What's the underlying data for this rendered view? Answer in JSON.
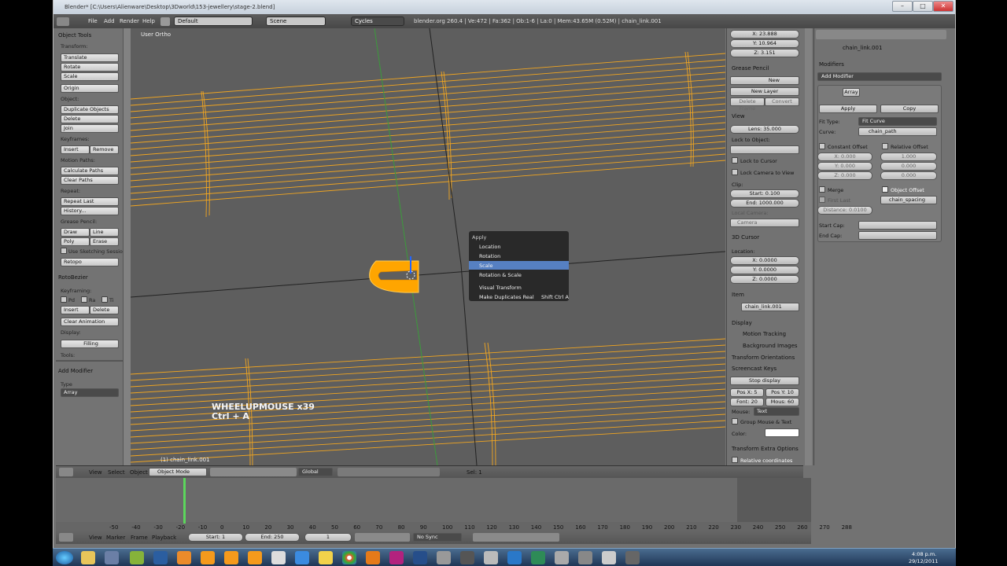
{
  "window": {
    "title": "Blender* [C:\\Users\\Alienware\\Desktop\\3Dworld\\153-jewellery\\stage-2.blend]"
  },
  "infobar": {
    "menus": [
      "File",
      "Add",
      "Render",
      "Help"
    ],
    "layout": "Default",
    "scene": "Scene",
    "engine": "Cycles",
    "stats": "blender.org 260.4 | Ve:472 | Fa:362 | Ob:1-6 | La:0 | Mem:43.65M (0.52M) | chain_link.001"
  },
  "toolshelf": {
    "object_tools": "Object Tools",
    "transform": "Transform:",
    "translate": "Translate",
    "rotate": "Rotate",
    "scale": "Scale",
    "origin": "Origin",
    "object": "Object:",
    "duplicate": "Duplicate Objects",
    "delete": "Delete",
    "join": "Join",
    "keyframes": "Keyframes:",
    "insert": "Insert",
    "remove": "Remove",
    "motion_paths": "Motion Paths:",
    "calc_paths": "Calculate Paths",
    "clear_paths": "Clear Paths",
    "repeat": "Repeat:",
    "repeat_last": "Repeat Last",
    "history": "History...",
    "grease_pencil": "Grease Pencil:",
    "draw": "Draw",
    "line": "Line",
    "poly": "Poly",
    "erase": "Erase",
    "use_sketching": "Use Sketching Sessio",
    "retopo": "Retopo",
    "rotobezier": "RotoBezier",
    "keyframing": "Keyframing:",
    "pd": "Pd",
    "ra": "Ra",
    "ti": "Ti",
    "insert2": "Insert",
    "delete2": "Delete",
    "clear_anim": "Clear Animation",
    "display": "Display:",
    "filling": "Filling",
    "tools": "Tools:",
    "add_modifier": "Add Modifier",
    "type": "Type",
    "type_value": "Array"
  },
  "viewport": {
    "view_name": "User Ortho",
    "object_label": "(1) chain_link.001",
    "keys_line1": "WHEELUPMOUSE x39",
    "keys_line2": "Ctrl + A"
  },
  "apply_menu": {
    "title": "Apply",
    "items": [
      "Location",
      "Rotation",
      "Scale",
      "Rotation & Scale",
      "Visual Transform",
      "Make Duplicates Real"
    ],
    "selected": "Scale",
    "shortcut": "Shift Ctrl A"
  },
  "npanel": {
    "x": "X: 23.888",
    "y": "Y: 10.964",
    "z": "Z: 3.151",
    "grease_pencil": "Grease Pencil",
    "new": "New",
    "new_layer": "New Layer",
    "delete_frame": "Delete Frame",
    "convert": "Convert",
    "view": "View",
    "lens": "Lens: 35.000",
    "lock_object": "Lock to Object:",
    "lock_cursor": "Lock to Cursor",
    "lock_camera": "Lock Camera to View",
    "clip": "Clip:",
    "clip_start": "Start: 0.100",
    "clip_end": "End: 1000.000",
    "local_camera": "Local Camera:",
    "camera": "Camera",
    "cursor3d": "3D Cursor",
    "location": "Location:",
    "cx": "X: 0.0000",
    "cy": "Y: 0.0000",
    "cz": "Z: 0.0000",
    "item": "Item",
    "item_name": "chain_link.001",
    "display": "Display",
    "motion_tracking": "Motion Tracking",
    "background_images": "Background Images",
    "transform_orientations": "Transform Orientations",
    "screencast_keys": "Screencast Keys",
    "stop_display": "Stop display",
    "posx": "Pos X: 5",
    "posy": "Pos Y: 10",
    "font": "Font: 20",
    "mous": "Mous: 60",
    "mouse": "Mouse:",
    "mouse_val": "Text",
    "group_mouse": "Group Mouse & Text",
    "color": "Color:",
    "extra_options": "Transform Extra Options",
    "relative": "Relative coordinates"
  },
  "props": {
    "object_name": "chain_link.001",
    "modifiers": "Modifiers",
    "add_modifier": "Add Modifier",
    "array": "Array",
    "apply": "Apply",
    "copy": "Copy",
    "fit_type": "Fit Type:",
    "fit_curve": "Fit Curve",
    "curve": "Curve:",
    "curve_val": "chain_path",
    "constant_offset": "Constant Offset",
    "relative_offset": "Relative Offset",
    "cx": "X: 0.000",
    "cy": "Y: 0.000",
    "cz": "Z: 0.000",
    "r1": "1.000",
    "r2": "0.000",
    "r3": "0.000",
    "merge": "Merge",
    "object_offset": "Object Offset",
    "first_last": "First Last",
    "spacing": "chain_spacing",
    "distance": "Distance: 0.0100",
    "start_cap": "Start Cap:",
    "end_cap": "End Cap:"
  },
  "v3dheader": {
    "view": "View",
    "select": "Select",
    "object": "Object",
    "mode": "Object Mode",
    "orientation": "Global",
    "sel": "Sel: 1"
  },
  "timeline": {
    "ticks": [
      "-50",
      "-40",
      "-30",
      "-20",
      "-10",
      "0",
      "10",
      "20",
      "30",
      "40",
      "50",
      "60",
      "70",
      "80",
      "90",
      "100",
      "110",
      "120",
      "130",
      "140",
      "150",
      "160",
      "170",
      "180",
      "190",
      "200",
      "210",
      "220",
      "230",
      "240",
      "250",
      "260",
      "270",
      "288"
    ],
    "view": "View",
    "marker": "Marker",
    "frame": "Frame",
    "playback": "Playback",
    "start": "Start: 1",
    "end": "End: 250",
    "current": "1",
    "sync": "No Sync"
  },
  "taskbar": {
    "time": "4:08 p.m.",
    "date": "29/12/2011"
  },
  "colors": {
    "wire": "#f0a020",
    "selected": "#ffa500",
    "menu_sel": "#5680c2"
  }
}
